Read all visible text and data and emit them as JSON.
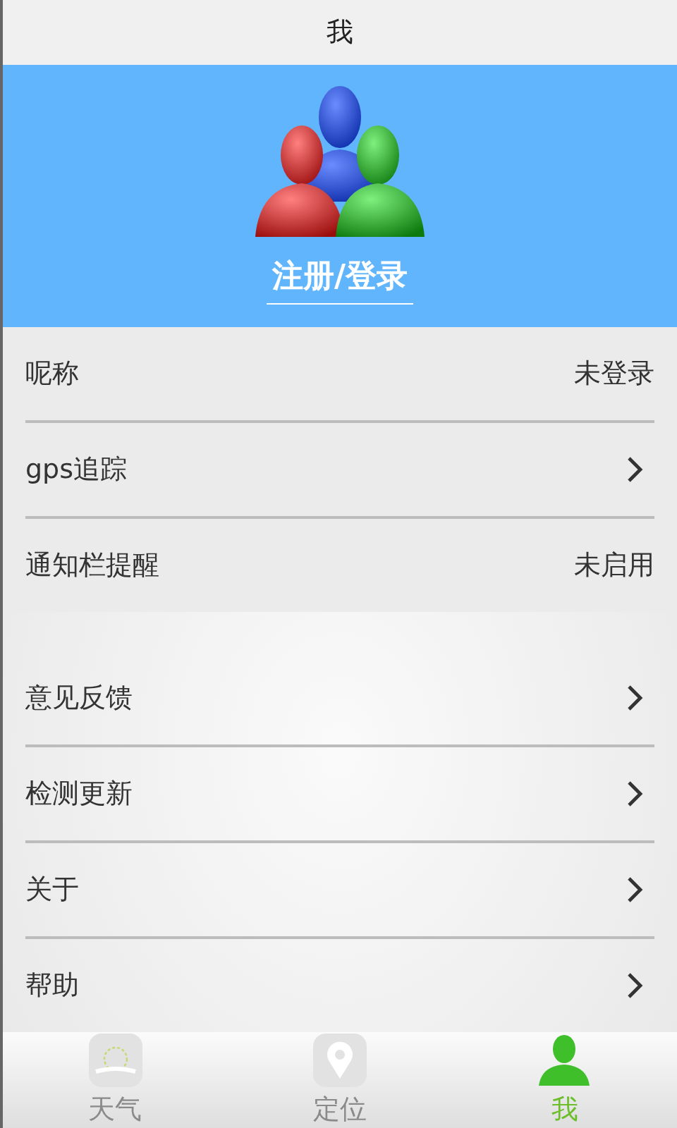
{
  "title": "我",
  "profile": {
    "login_label": "注册/登录"
  },
  "groups": [
    {
      "rows": [
        {
          "label": "呢称",
          "kind": "value",
          "value": "未登录"
        },
        {
          "label": "gps追踪",
          "kind": "arrow"
        },
        {
          "label": "通知栏提醒",
          "kind": "value",
          "value": "未启用"
        }
      ]
    },
    {
      "rows": [
        {
          "label": "意见反馈",
          "kind": "arrow"
        },
        {
          "label": "检测更新",
          "kind": "arrow"
        },
        {
          "label": "关于",
          "kind": "arrow"
        },
        {
          "label": "帮助",
          "kind": "arrow"
        }
      ]
    }
  ],
  "tabs": [
    {
      "label": "天气",
      "kind": "weather",
      "selected": false
    },
    {
      "label": "定位",
      "kind": "location",
      "selected": false
    },
    {
      "label": "我",
      "kind": "person",
      "selected": true
    }
  ]
}
